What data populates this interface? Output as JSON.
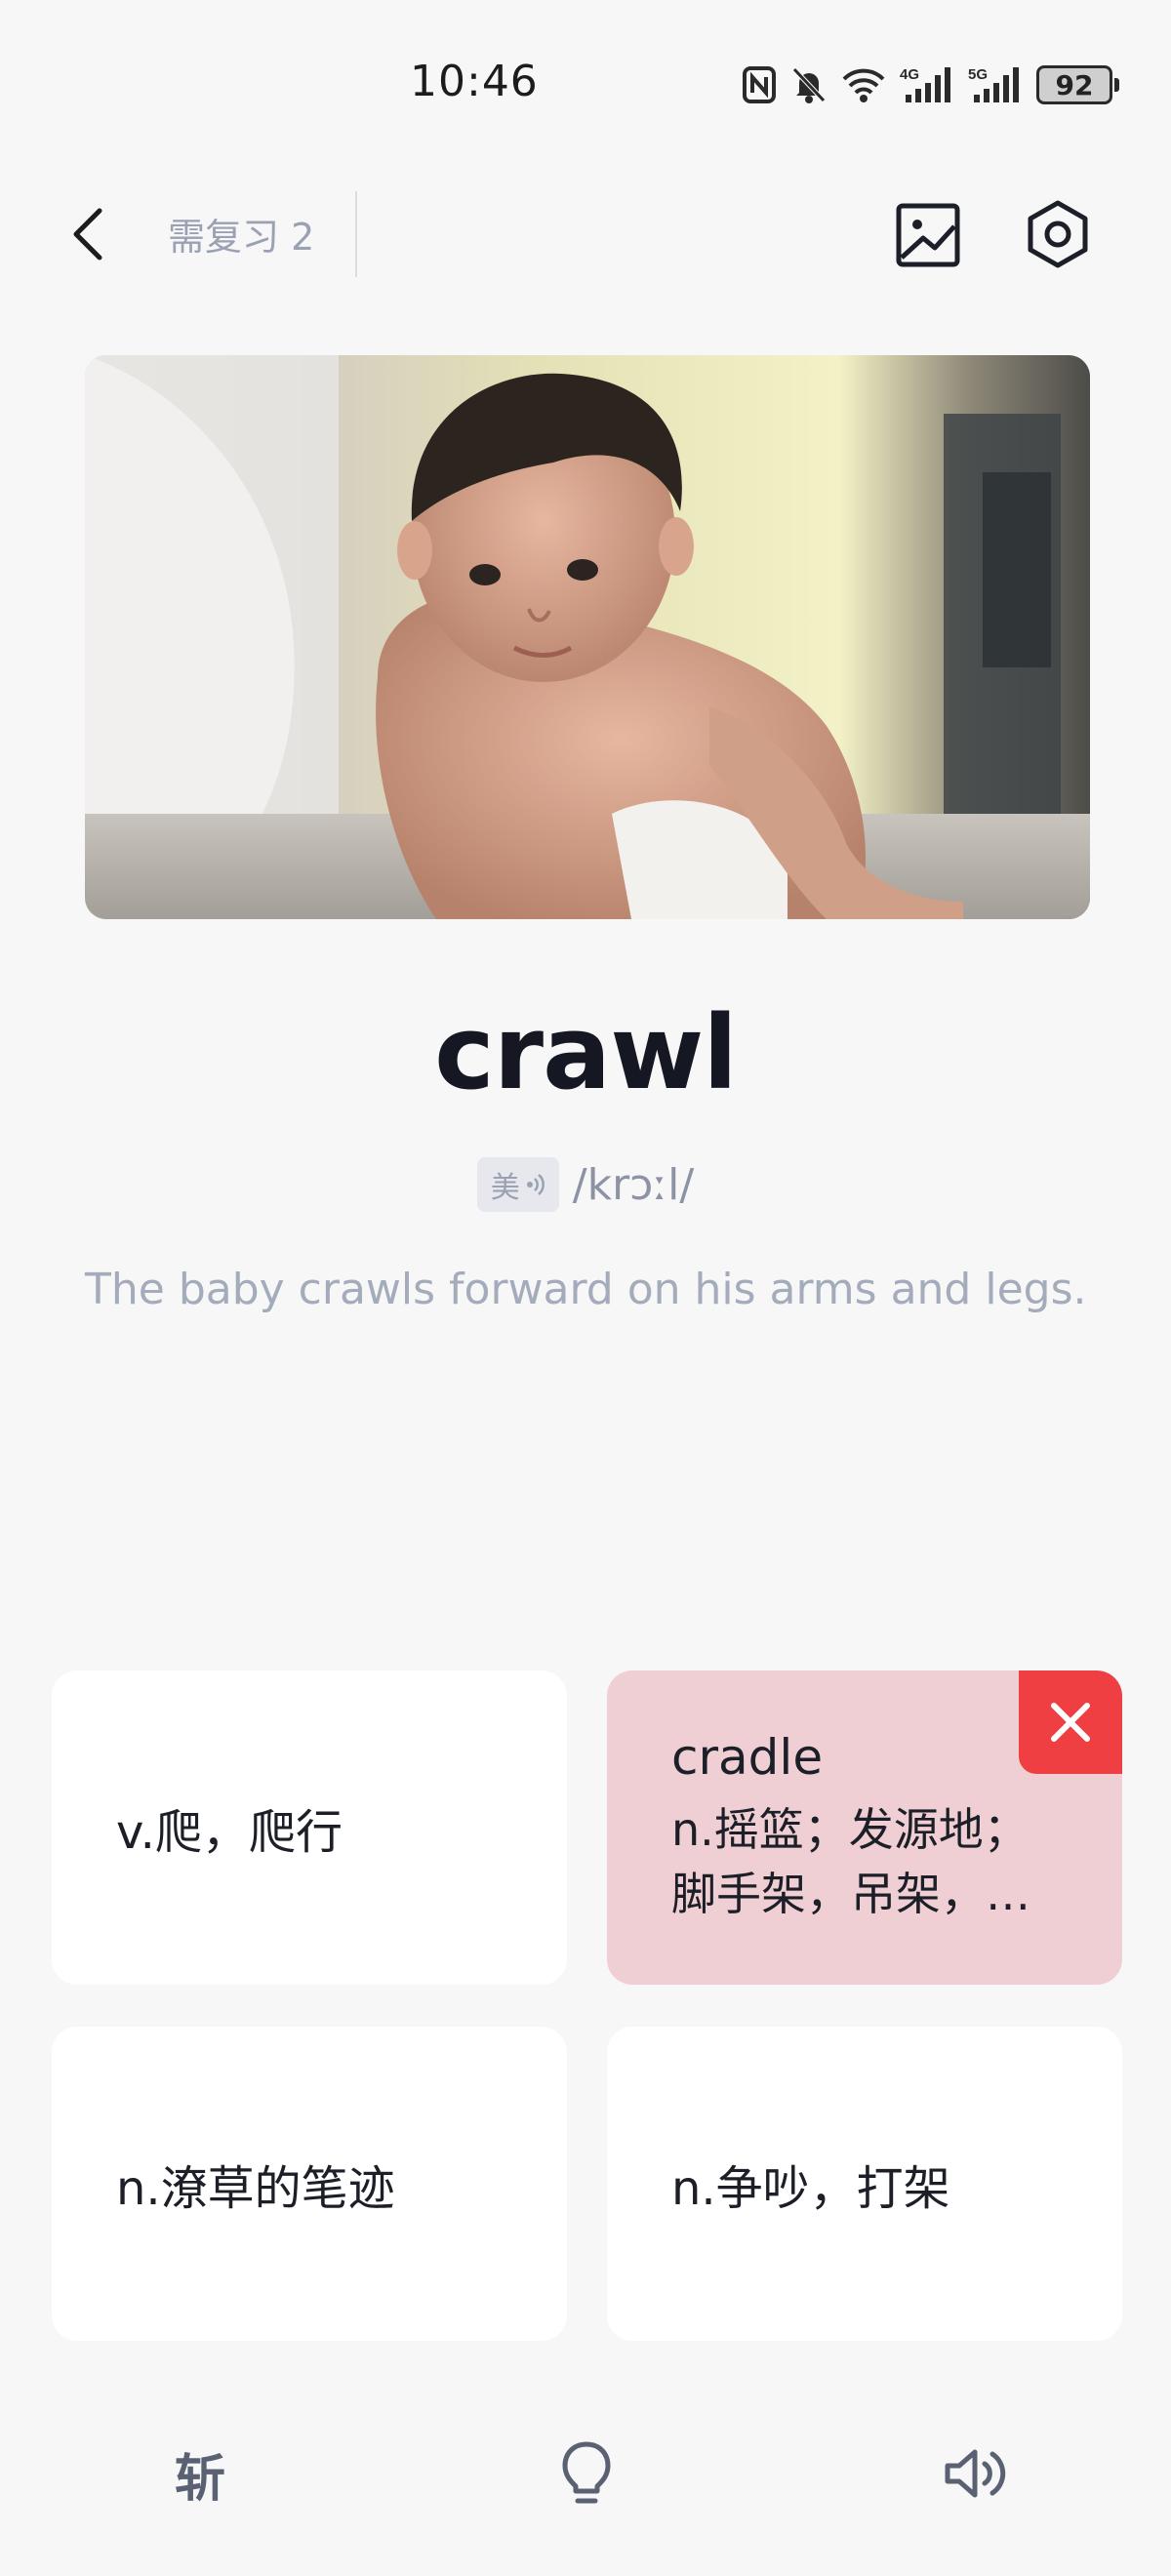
{
  "status_bar": {
    "time": "10:46",
    "battery": "92",
    "icons": [
      "nfc-icon",
      "mute-icon",
      "wifi-icon",
      "4g-signal-icon",
      "5g-signal-icon",
      "battery-icon"
    ]
  },
  "nav": {
    "review_label": "需复习 2",
    "icons": [
      "back-icon",
      "image-icon",
      "settings-icon"
    ]
  },
  "word": {
    "text": "crawl",
    "accent": "美",
    "phonetic": "/krɔːl/",
    "example": "The baby crawls forward on his arms and legs."
  },
  "options": [
    {
      "text": "v.爬，爬行"
    },
    {
      "word": "cradle",
      "definition": "n.摇篮；发源地；脚手架，吊架，…",
      "state": "wrong"
    },
    {
      "text": "n.潦草的笔迹"
    },
    {
      "text": "n.争吵，打架"
    }
  ],
  "bottom": {
    "zhan_label": "斩",
    "icons": [
      "hint-bulb-icon",
      "speaker-icon"
    ]
  },
  "colors": {
    "background": "#f7f7f7",
    "card": "#ffffff",
    "wrong_card": "#efcfd3",
    "wrong_mark": "#ef3f42",
    "muted_text": "#a4abbb"
  }
}
